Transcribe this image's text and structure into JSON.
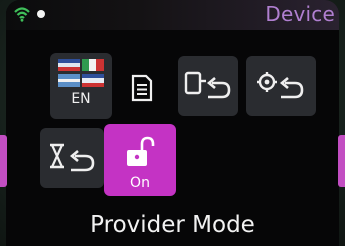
{
  "header": {
    "title": "Device",
    "wifi_icon": "wifi-icon",
    "status_dot": "status-dot"
  },
  "tiles": {
    "language": {
      "label": "EN",
      "icon": "flags-icon"
    },
    "document": {
      "icon": "document-icon"
    },
    "device_back": {
      "icon": "device-return-icon"
    },
    "settings_back": {
      "icon": "gear-return-icon"
    },
    "timer_back": {
      "icon": "hourglass-return-icon"
    },
    "provider_lock": {
      "label": "On",
      "icon": "unlock-icon",
      "selected": true
    }
  },
  "footer": {
    "label": "Provider Mode"
  },
  "colors": {
    "accent": "#c433c4",
    "header_text": "#b07fd0",
    "tile": "#2a2c30"
  }
}
